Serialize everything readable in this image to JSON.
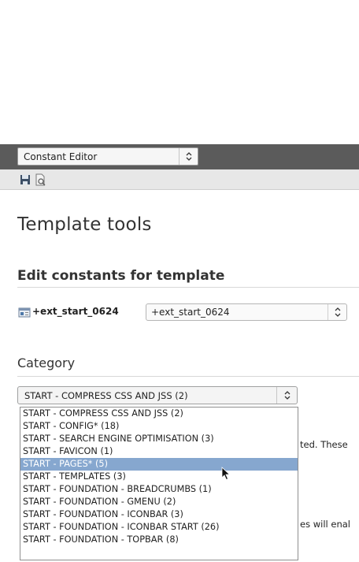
{
  "module_menu": {
    "selected": "Constant Editor"
  },
  "docheader": {
    "icons": [
      "save-icon",
      "view-icon"
    ]
  },
  "page_title": "Template tools",
  "section_title": "Edit constants for template",
  "template": {
    "label": "+ext_start_0624",
    "select_value": "+ext_start_0624"
  },
  "category": {
    "heading": "Category",
    "selected": "START - COMPRESS CSS AND JSS (2)",
    "options": [
      "START - COMPRESS CSS AND JSS (2)",
      "START - CONFIG* (18)",
      "START - SEARCH ENGINE OPTIMISATION (3)",
      "START - FAVICON (1)",
      "START - PAGES* (5)",
      "START - TEMPLATES (3)",
      "START - FOUNDATION - BREADCRUMBS (1)",
      "START - FOUNDATION - GMENU (2)",
      "START - FOUNDATION - ICONBAR (3)",
      "START - FOUNDATION - ICONBAR START (26)",
      "START - FOUNDATION - TOPBAR (8)"
    ],
    "highlighted_index": 4
  },
  "background_text": {
    "line1": "ted. These",
    "line2": "es will enal"
  }
}
